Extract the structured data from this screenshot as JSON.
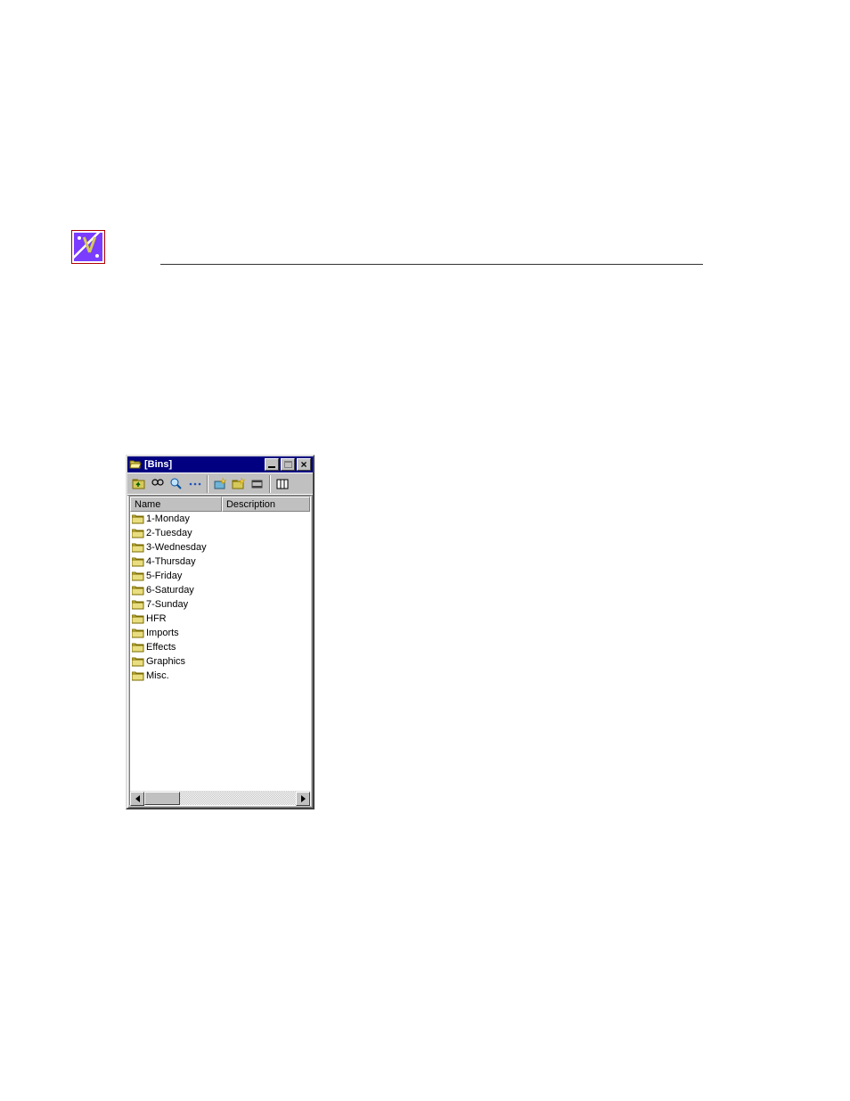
{
  "window": {
    "title": "[Bins]"
  },
  "toolbar": {
    "items": [
      {
        "name": "up-folder-icon"
      },
      {
        "name": "find-icon"
      },
      {
        "name": "explore-icon"
      },
      {
        "name": "rename-icon"
      },
      {
        "sep": true
      },
      {
        "name": "new-bin-icon"
      },
      {
        "name": "new-folder-icon"
      },
      {
        "name": "new-sequence-icon"
      },
      {
        "sep": true
      },
      {
        "name": "columns-icon"
      }
    ]
  },
  "columns": [
    {
      "label": "Name",
      "width": 104
    },
    {
      "label": "Description",
      "width": 100
    }
  ],
  "bins": [
    {
      "name": "1-Monday"
    },
    {
      "name": "2-Tuesday"
    },
    {
      "name": "3-Wednesday"
    },
    {
      "name": "4-Thursday"
    },
    {
      "name": "5-Friday"
    },
    {
      "name": "6-Saturday"
    },
    {
      "name": "7-Sunday"
    },
    {
      "name": "HFR"
    },
    {
      "name": "Imports"
    },
    {
      "name": "Effects"
    },
    {
      "name": "Graphics"
    },
    {
      "name": "Misc."
    }
  ]
}
